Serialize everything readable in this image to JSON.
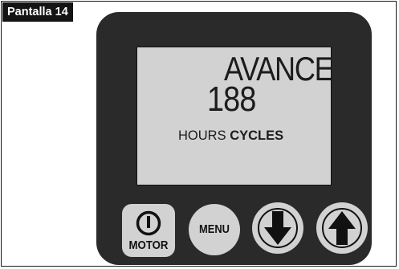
{
  "screen_tag": "Pantalla 14",
  "display": {
    "title": "AVANCE",
    "value": "188",
    "unit_hours": "HOURS",
    "unit_cycles": "CYCLES"
  },
  "buttons": {
    "motor_label": "MOTOR",
    "menu_label": "MENU"
  },
  "icons": [
    "power-icon",
    "arrow-down-icon",
    "arrow-up-icon"
  ],
  "colors": {
    "device_body": "#2a2a2a",
    "lcd_background": "#d2d2d2",
    "button_face": "#d2d2d2",
    "tag_background": "#141414"
  }
}
